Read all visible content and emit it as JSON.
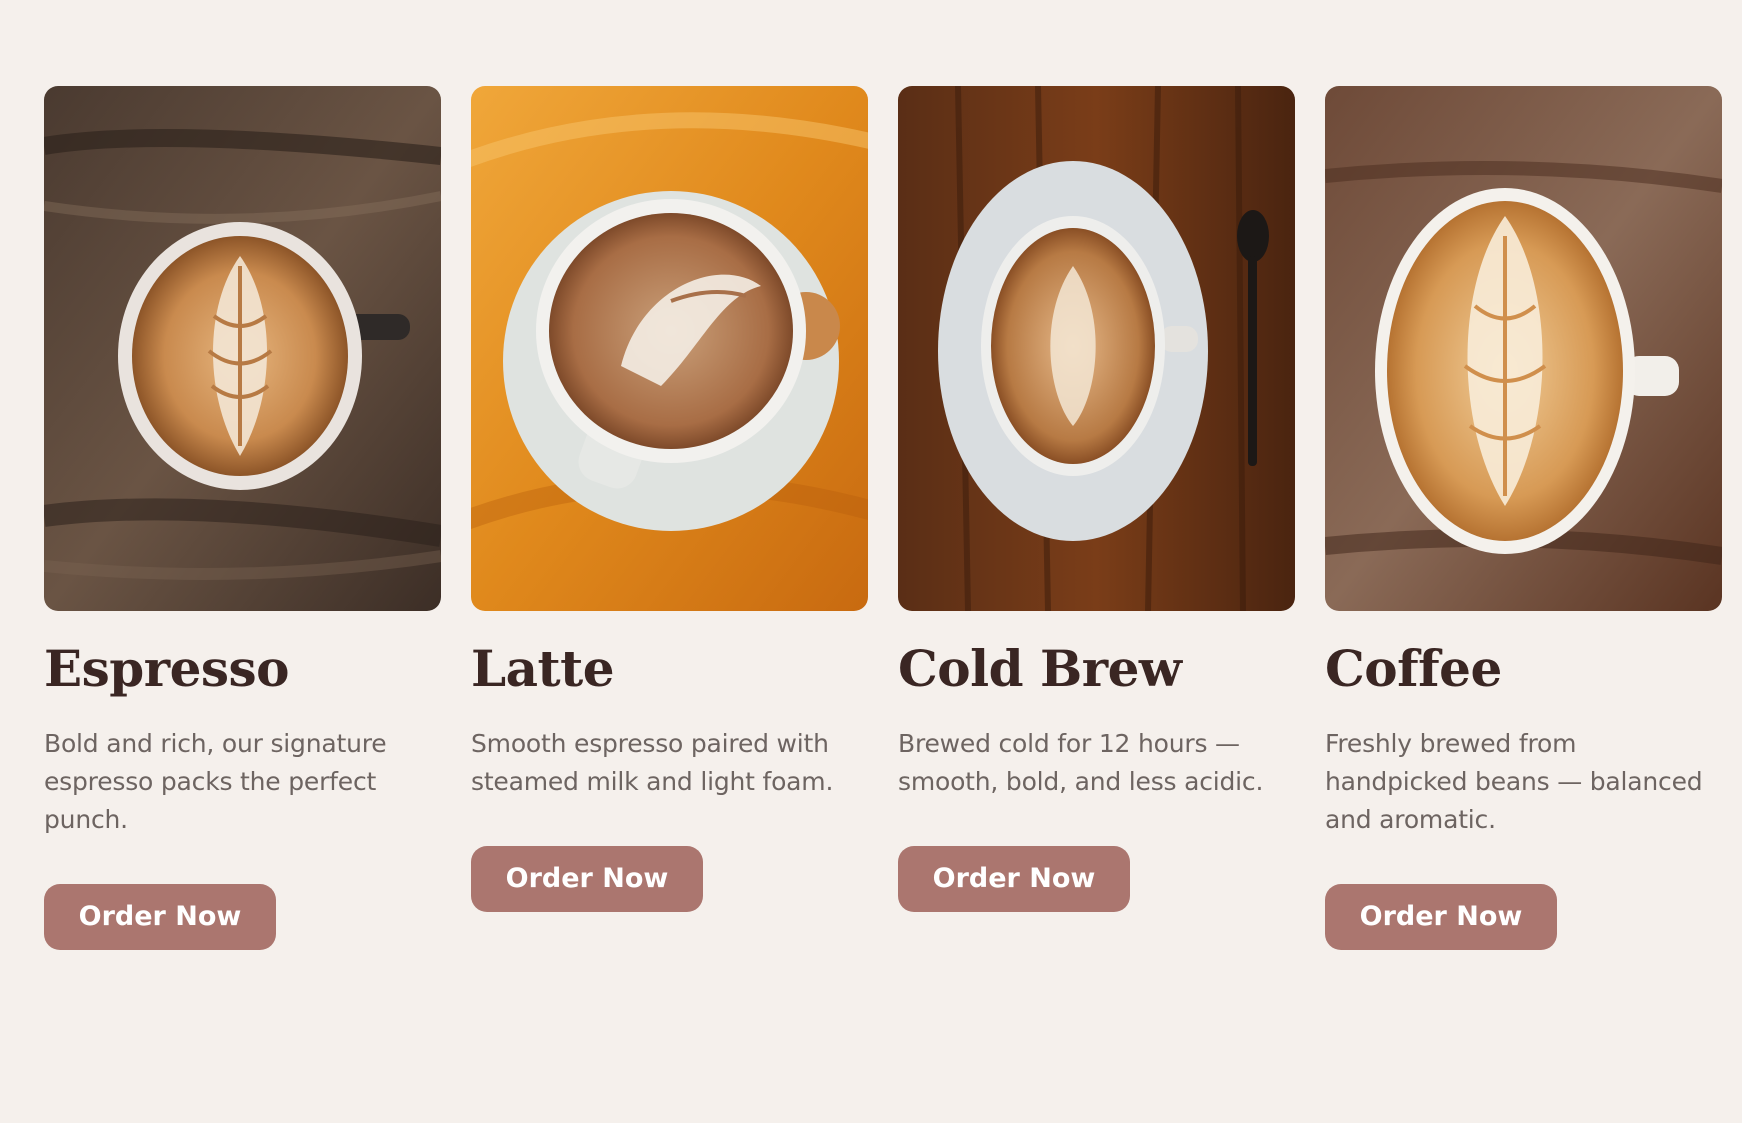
{
  "products": [
    {
      "name": "Espresso",
      "description": "Bold and rich, our signature espresso packs the perfect punch.",
      "button_label": "Order Now"
    },
    {
      "name": "Latte",
      "description": "Smooth espresso paired with steamed milk and light foam.",
      "button_label": "Order Now"
    },
    {
      "name": "Cold Brew",
      "description": "Brewed cold for 12 hours — smooth, bold, and less acidic.",
      "button_label": "Order Now"
    },
    {
      "name": "Coffee",
      "description": "Freshly brewed from handpicked beans — balanced and aromatic.",
      "button_label": "Order Now"
    }
  ],
  "colors": {
    "background": "#f5f0ec",
    "title": "#3a2623",
    "description": "#6d6461",
    "button": "#ab766f",
    "button_text": "#ffffff"
  },
  "icons": {
    "photos": [
      "latte-art-photo",
      "latte-saucer-photo",
      "cold-brew-cup-photo",
      "latte-art-photo"
    ]
  }
}
